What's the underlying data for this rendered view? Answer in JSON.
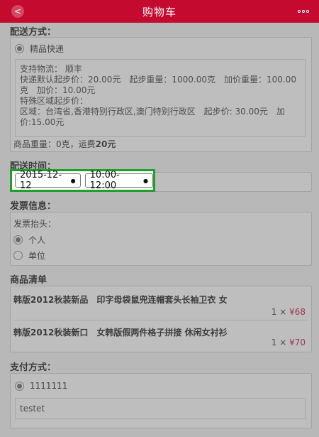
{
  "header": {
    "title": "购物车",
    "back_glyph": "<",
    "more_label": "more"
  },
  "shipping": {
    "section_title": "配送方式：",
    "method_name": "精品快递",
    "details": [
      "支持物流： 顺丰",
      "快递默认起步价：20.00元　起步重量：1000.00克　加价重量：100.00",
      "克　加价：10.00元",
      "特殊区域起步价：",
      "区域：台湾省,香港特别行政区,澳门特别行政区　起步价: 30.00元　加",
      "价:15.00元"
    ],
    "weight_prefix": "商品重量：0克，运费",
    "freight": "20元"
  },
  "delivery_time": {
    "section_title": "配送时间：",
    "date_value": "2015-12-12",
    "time_value": "10:00-12:00"
  },
  "invoice": {
    "section_title": "发票信息：",
    "header_label": "发票抬头：",
    "options": [
      {
        "label": "个人",
        "selected": true
      },
      {
        "label": "单位",
        "selected": false
      }
    ]
  },
  "items": {
    "section_title": "商品清单",
    "list": [
      {
        "title": "韩版2012秋装新品　印字母袋鼠兜连帽套头长袖卫衣 女",
        "qty": "1 ×",
        "price": "¥68"
      },
      {
        "title": "韩版2012秋装新口　女韩版假两件格子拼接 休闲女衬衫",
        "qty": "1 ×",
        "price": "¥70"
      }
    ]
  },
  "payment": {
    "section_title": "支付方式：",
    "option_label": "1111111",
    "note": "testet"
  },
  "colors": {
    "brand_red": "#c40a2e",
    "highlight_green": "#1fa02b"
  }
}
